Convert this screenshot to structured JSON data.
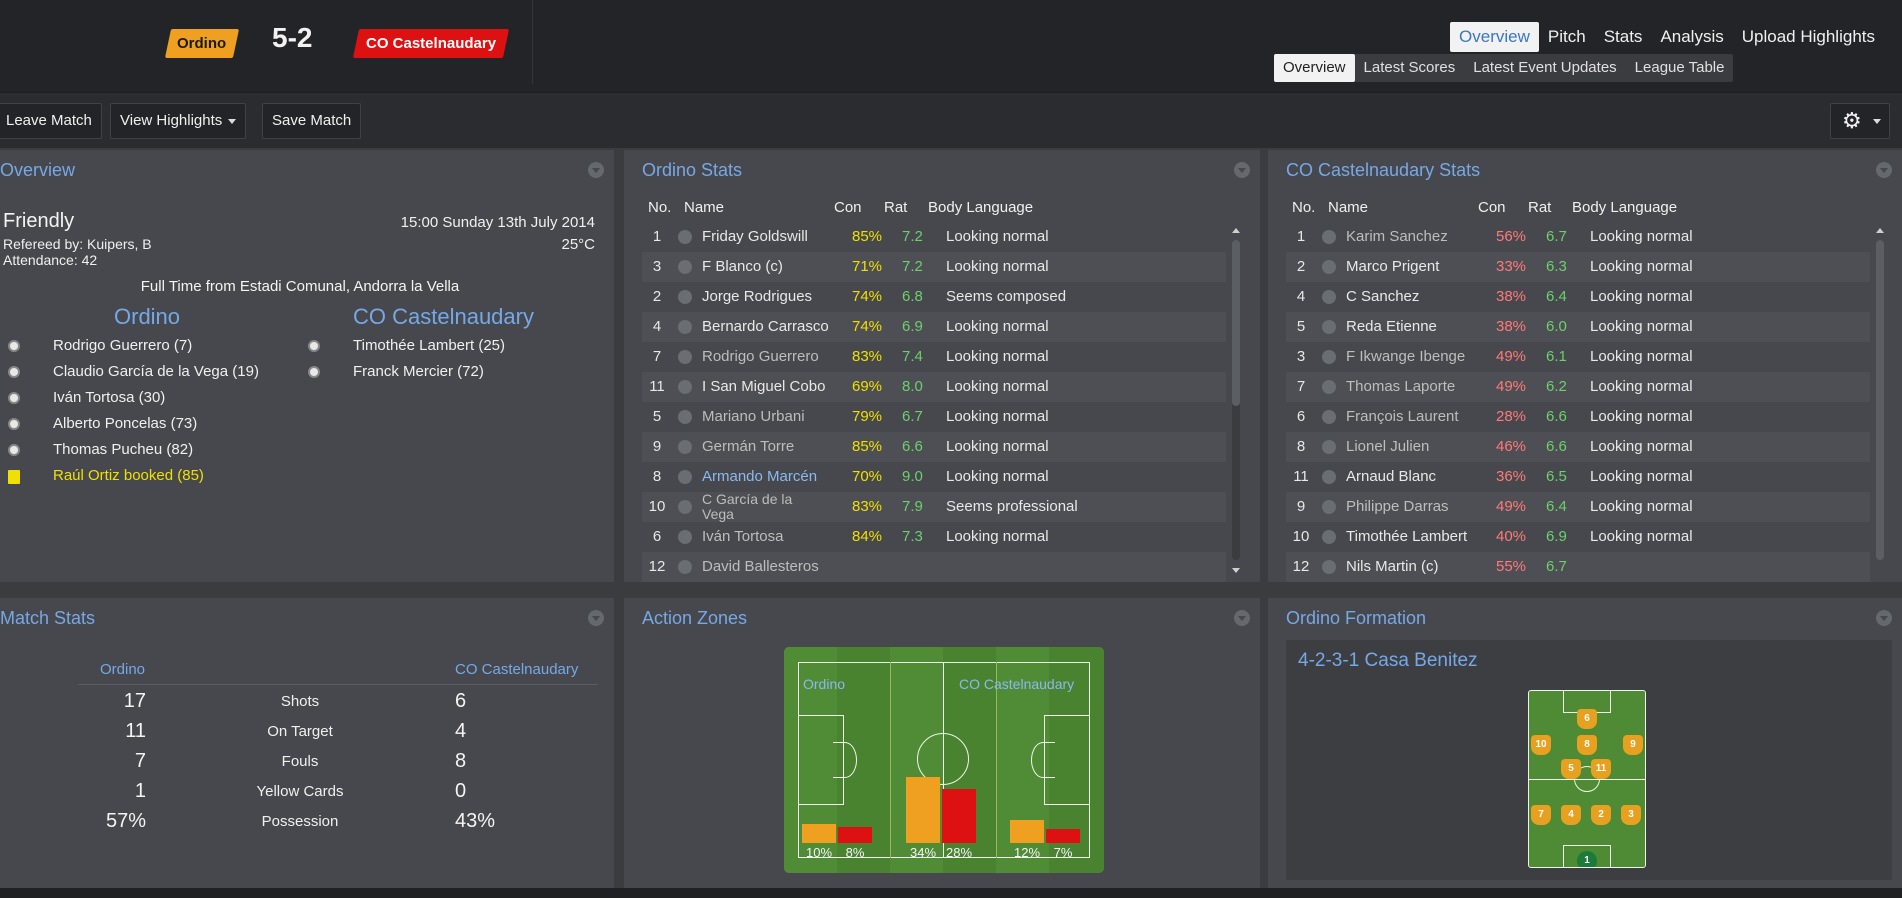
{
  "header": {
    "home_team": "Ordino",
    "away_team": "CO Castelnaudary",
    "score": "5-2",
    "home_color": "#f0a020",
    "away_color": "#dd1111",
    "top_nav": [
      "Overview",
      "Pitch",
      "Stats",
      "Analysis",
      "Upload Highlights"
    ],
    "sub_nav": [
      "Overview",
      "Latest Scores",
      "Latest Event Updates",
      "League Table"
    ]
  },
  "toolbar": {
    "leave": "Leave Match",
    "highlights": "View Highlights",
    "save": "Save Match",
    "settings_icon": "gear-icon"
  },
  "overview": {
    "title": "Overview",
    "competition": "Friendly",
    "referee": "Refereed by: Kuipers, B",
    "attendance": "Attendance: 42",
    "date": "15:00 Sunday 13th July 2014",
    "temperature": "25°C",
    "full_time": "Full Time from Estadi Comunal, Andorra la Vella",
    "home_team": "Ordino",
    "away_team": "CO Castelnaudary",
    "home_events": [
      {
        "text": "Rodrigo Guerrero (7)",
        "type": "goal"
      },
      {
        "text": "Claudio García de la Vega (19)",
        "type": "goal"
      },
      {
        "text": "Iván Tortosa (30)",
        "type": "goal"
      },
      {
        "text": "Alberto Poncelas (73)",
        "type": "goal"
      },
      {
        "text": "Thomas Pucheu (82)",
        "type": "goal"
      },
      {
        "text": "Raúl Ortiz booked (85)",
        "type": "yellow"
      }
    ],
    "away_events": [
      {
        "text": "Timothée Lambert (25)",
        "type": "goal"
      },
      {
        "text": "Franck Mercier (72)",
        "type": "goal"
      }
    ]
  },
  "ordino_stats": {
    "title": "Ordino Stats",
    "columns": [
      "No.",
      "Name",
      "Con",
      "Rat",
      "Body Language"
    ],
    "rows": [
      {
        "no": "1",
        "name": "Friday Goldswill",
        "con": "85%",
        "rat": "7.2",
        "body": "Looking normal",
        "style": ""
      },
      {
        "no": "3",
        "name": "F Blanco (c)",
        "con": "71%",
        "rat": "7.2",
        "body": "Looking normal",
        "style": ""
      },
      {
        "no": "2",
        "name": "Jorge Rodrigues",
        "con": "74%",
        "rat": "6.8",
        "body": "Seems composed",
        "style": ""
      },
      {
        "no": "4",
        "name": "Bernardo Carrasco",
        "con": "74%",
        "rat": "6.9",
        "body": "Looking normal",
        "style": ""
      },
      {
        "no": "7",
        "name": "Rodrigo Guerrero",
        "con": "83%",
        "rat": "7.4",
        "body": "Looking normal",
        "style": "dim"
      },
      {
        "no": "11",
        "name": "I San Miguel Cobo",
        "con": "69%",
        "rat": "8.0",
        "body": "Looking normal",
        "style": ""
      },
      {
        "no": "5",
        "name": "Mariano Urbani",
        "con": "79%",
        "rat": "6.7",
        "body": "Looking normal",
        "style": "dim"
      },
      {
        "no": "9",
        "name": "Germán Torre",
        "con": "85%",
        "rat": "6.6",
        "body": "Looking normal",
        "style": "dim"
      },
      {
        "no": "8",
        "name": "Armando Marcén",
        "con": "70%",
        "rat": "9.0",
        "body": "Looking normal",
        "style": "link"
      },
      {
        "no": "10",
        "name": "C García de la Vega",
        "con": "83%",
        "rat": "7.9",
        "body": "Seems professional",
        "style": "dim"
      },
      {
        "no": "6",
        "name": "Iván Tortosa",
        "con": "84%",
        "rat": "7.3",
        "body": "Looking normal",
        "style": "dim"
      },
      {
        "no": "12",
        "name": "David Ballesteros",
        "con": "",
        "rat": "",
        "body": "",
        "style": "dim"
      }
    ]
  },
  "away_stats": {
    "title": "CO Castelnaudary Stats",
    "columns": [
      "No.",
      "Name",
      "Con",
      "Rat",
      "Body Language"
    ],
    "rows": [
      {
        "no": "1",
        "name": "Karim Sanchez",
        "con": "56%",
        "rat": "6.7",
        "body": "Looking normal",
        "style": "dim"
      },
      {
        "no": "2",
        "name": "Marco Prigent",
        "con": "33%",
        "rat": "6.3",
        "body": "Looking normal",
        "style": ""
      },
      {
        "no": "4",
        "name": "C Sanchez",
        "con": "38%",
        "rat": "6.4",
        "body": "Looking normal",
        "style": ""
      },
      {
        "no": "5",
        "name": "Reda Etienne",
        "con": "38%",
        "rat": "6.0",
        "body": "Looking normal",
        "style": ""
      },
      {
        "no": "3",
        "name": "F Ikwange Ibenge",
        "con": "49%",
        "rat": "6.1",
        "body": "Looking normal",
        "style": "dim"
      },
      {
        "no": "7",
        "name": "Thomas Laporte",
        "con": "49%",
        "rat": "6.2",
        "body": "Looking normal",
        "style": "dim"
      },
      {
        "no": "6",
        "name": "François Laurent",
        "con": "28%",
        "rat": "6.6",
        "body": "Looking normal",
        "style": "dim"
      },
      {
        "no": "8",
        "name": "Lionel Julien",
        "con": "46%",
        "rat": "6.6",
        "body": "Looking normal",
        "style": "dim"
      },
      {
        "no": "11",
        "name": "Arnaud Blanc",
        "con": "36%",
        "rat": "6.5",
        "body": "Looking normal",
        "style": ""
      },
      {
        "no": "9",
        "name": "Philippe Darras",
        "con": "49%",
        "rat": "6.4",
        "body": "Looking normal",
        "style": "dim"
      },
      {
        "no": "10",
        "name": "Timothée Lambert",
        "con": "40%",
        "rat": "6.9",
        "body": "Looking normal",
        "style": ""
      },
      {
        "no": "12",
        "name": "Nils Martin (c)",
        "con": "55%",
        "rat": "6.7",
        "body": "",
        "style": ""
      }
    ]
  },
  "match_stats": {
    "title": "Match Stats",
    "home_team": "Ordino",
    "away_team": "CO Castelnaudary",
    "rows": [
      {
        "home": "17",
        "label": "Shots",
        "away": "6"
      },
      {
        "home": "11",
        "label": "On Target",
        "away": "4"
      },
      {
        "home": "7",
        "label": "Fouls",
        "away": "8"
      },
      {
        "home": "1",
        "label": "Yellow Cards",
        "away": "0"
      },
      {
        "home": "57%",
        "label": "Possession",
        "away": "43%"
      }
    ]
  },
  "action_zones": {
    "title": "Action Zones",
    "home_team": "Ordino",
    "away_team": "CO Castelnaudary",
    "zones": [
      {
        "home": 10,
        "away": 8,
        "home_label": "10%",
        "away_label": "8%"
      },
      {
        "home": 34,
        "away": 28,
        "home_label": "34%",
        "away_label": "28%"
      },
      {
        "home": 12,
        "away": 7,
        "home_label": "12%",
        "away_label": "7%"
      }
    ]
  },
  "formation": {
    "title": "Ordino Formation",
    "name": "4-2-3-1 Casa Benitez",
    "players": [
      "6",
      "10",
      "8",
      "9",
      "5",
      "11",
      "7",
      "4",
      "2",
      "3",
      "1"
    ]
  }
}
